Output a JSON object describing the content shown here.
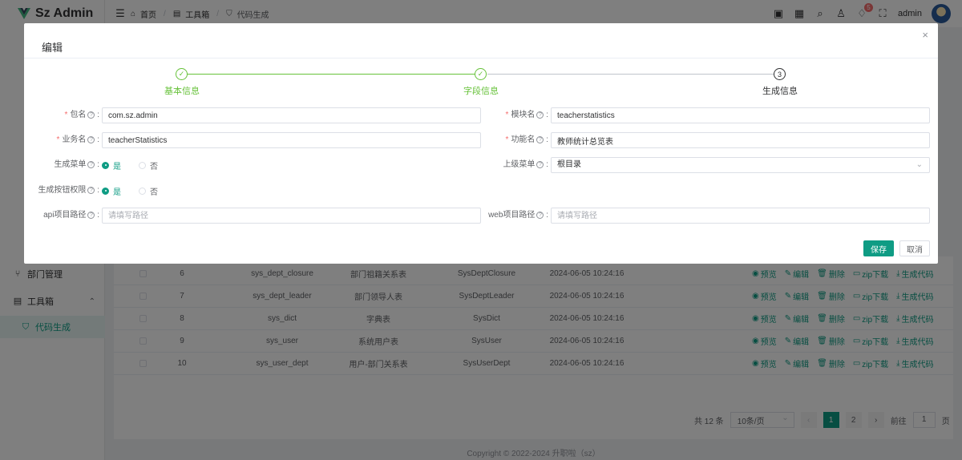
{
  "app": {
    "name": "Sz Admin"
  },
  "header": {
    "breadcrumb": [
      "首页",
      "工具箱",
      "代码生成"
    ],
    "notification_count": "5",
    "username": "admin"
  },
  "sidebar": {
    "items": [
      {
        "label": "部门管理"
      },
      {
        "label": "工具箱"
      },
      {
        "label": "代码生成"
      }
    ]
  },
  "table": {
    "rows": [
      {
        "index": "6",
        "table_name": "sys_dept_closure",
        "comment": "部门祖籍关系表",
        "class_name": "SysDeptClosure",
        "time": "2024-06-05 10:24:16"
      },
      {
        "index": "7",
        "table_name": "sys_dept_leader",
        "comment": "部门领导人表",
        "class_name": "SysDeptLeader",
        "time": "2024-06-05 10:24:16"
      },
      {
        "index": "8",
        "table_name": "sys_dict",
        "comment": "字典表",
        "class_name": "SysDict",
        "time": "2024-06-05 10:24:16"
      },
      {
        "index": "9",
        "table_name": "sys_user",
        "comment": "系统用户表",
        "class_name": "SysUser",
        "time": "2024-06-05 10:24:16"
      },
      {
        "index": "10",
        "table_name": "sys_user_dept",
        "comment": "用户-部门关系表",
        "class_name": "SysUserDept",
        "time": "2024-06-05 10:24:16"
      }
    ],
    "actions": [
      "预览",
      "编辑",
      "删除",
      "zip下载",
      "生成代码"
    ]
  },
  "pagination": {
    "total": "共 12 条",
    "page_size": "10条/页",
    "pages": [
      "1",
      "2"
    ],
    "goto_label": "前往",
    "goto_value": "1",
    "page_unit": "页"
  },
  "footer": "Copyright © 2022-2024 升职啦（sz）",
  "dialog": {
    "title": "编辑",
    "close": "×",
    "steps": [
      {
        "label": "基本信息",
        "state": "done"
      },
      {
        "label": "字段信息",
        "state": "done"
      },
      {
        "label": "生成信息",
        "state": "current",
        "number": "3"
      }
    ],
    "fields": {
      "package_label": "包名",
      "package_value": "com.sz.admin",
      "module_label": "模块名",
      "module_value": "teacherstatistics",
      "business_label": "业务名",
      "business_value": "teacherStatistics",
      "function_label": "功能名",
      "function_value": "教师统计总览表",
      "gen_menu_label": "生成菜单",
      "parent_menu_label": "上级菜单",
      "parent_menu_value": "根目录",
      "gen_btn_label": "生成按钮权限",
      "api_path_label": "api项目路径",
      "api_path_placeholder": "请填写路径",
      "web_path_label": "web项目路径",
      "web_path_placeholder": "请填写路径"
    },
    "radio": {
      "yes": "是",
      "no": "否"
    },
    "buttons": {
      "save": "保存",
      "cancel": "取消"
    }
  },
  "colors": {
    "primary": "#0f9c84",
    "step_done": "#67c23a",
    "required": "#f56c6c"
  }
}
